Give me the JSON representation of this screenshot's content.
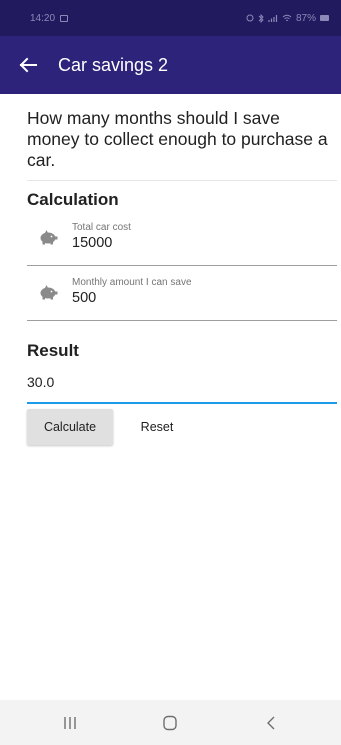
{
  "status_bar": {
    "time": "14:20",
    "right_text": "87%"
  },
  "app_bar": {
    "title": "Car savings 2"
  },
  "question": "How many months should I save money to collect enough to purchase a car.",
  "calculation": {
    "title": "Calculation",
    "fields": [
      {
        "label": "Total car cost",
        "value": "15000",
        "icon": "piggy-bank-icon"
      },
      {
        "label": "Monthly amount I can save",
        "value": "500",
        "icon": "piggy-bank-icon"
      }
    ]
  },
  "result": {
    "title": "Result",
    "value": "30.0"
  },
  "buttons": {
    "calculate": "Calculate",
    "reset": "Reset"
  },
  "colors": {
    "status_bar": "#221a5e",
    "app_bar": "#2d237a",
    "accent": "#1e9be8"
  }
}
